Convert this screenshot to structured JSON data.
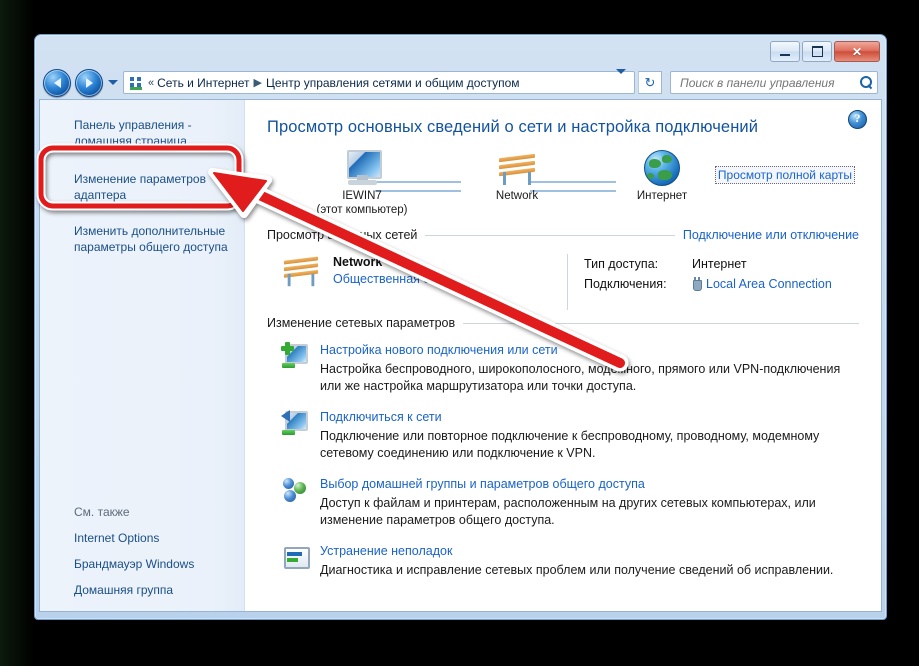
{
  "window": {
    "buttons": {
      "minimize": "minimize-button",
      "maximize": "maximize-button",
      "close": "close-button"
    }
  },
  "addressbar": {
    "back": "Назад",
    "forward": "Вперёд",
    "chevrons": "«",
    "crumb1": "Сеть и Интернет",
    "crumb_sep": "▶",
    "crumb2": "Центр управления сетями и общим доступом",
    "refresh": "↻",
    "search_placeholder": "Поиск в панели управления"
  },
  "sidebar": {
    "items": [
      {
        "label": "Панель управления - домашняя страница",
        "name": "sidebar-item-control-panel-home"
      },
      {
        "label": "Изменение параметров адаптера",
        "name": "sidebar-item-change-adapter-settings"
      },
      {
        "label": "Изменить дополнительные параметры общего доступа",
        "name": "sidebar-item-advanced-sharing-settings"
      }
    ],
    "see_also_title": "См. также",
    "see_also": [
      {
        "label": "Internet Options",
        "name": "sidebar-item-internet-options"
      },
      {
        "label": "Брандмауэр Windows",
        "name": "sidebar-item-windows-firewall"
      },
      {
        "label": "Домашняя группа",
        "name": "sidebar-item-homegroup"
      }
    ]
  },
  "content": {
    "help": "?",
    "page_title": "Просмотр основных сведений о сети и настройка подключений",
    "map": {
      "node1_label": "IEWIN7",
      "node1_sub": "(этот компьютер)",
      "node2_label": "Network",
      "node3_label": "Интернет",
      "full_map_link": "Просмотр полной карты"
    },
    "active_networks": {
      "section_title": "Просмотр активных сетей",
      "section_link": "Подключение или отключение",
      "network_name": "Network",
      "network_type": "Общественная сеть",
      "access_key": "Тип доступа:",
      "access_value": "Интернет",
      "connections_key": "Подключения:",
      "connections_value": "Local Area Connection"
    },
    "change_settings": {
      "section_title": "Изменение сетевых параметров",
      "tasks": [
        {
          "icon": "new-connection-icon",
          "link": "Настройка нового подключения или сети",
          "desc": "Настройка беспроводного, широкополосного, модемного, прямого или VPN-подключения или же настройка маршрутизатора или точки доступа."
        },
        {
          "icon": "connect-to-network-icon",
          "link": "Подключиться к сети",
          "desc": "Подключение или повторное подключение к беспроводному, проводному, модемному сетевому соединению или подключение к VPN."
        },
        {
          "icon": "homegroup-icon",
          "link": "Выбор домашней группы и параметров общего доступа",
          "desc": "Доступ к файлам и принтерам, расположенным на других сетевых компьютерах, или изменение параметров общего доступа."
        },
        {
          "icon": "troubleshoot-icon",
          "link": "Устранение неполадок",
          "desc": "Диагностика и исправление сетевых проблем или получение сведений об исправлении."
        }
      ]
    }
  },
  "annotation": {
    "highlight_target": "sidebar-item-change-adapter-settings",
    "color": "#e01b1b",
    "outline_color": "#ffffff"
  }
}
